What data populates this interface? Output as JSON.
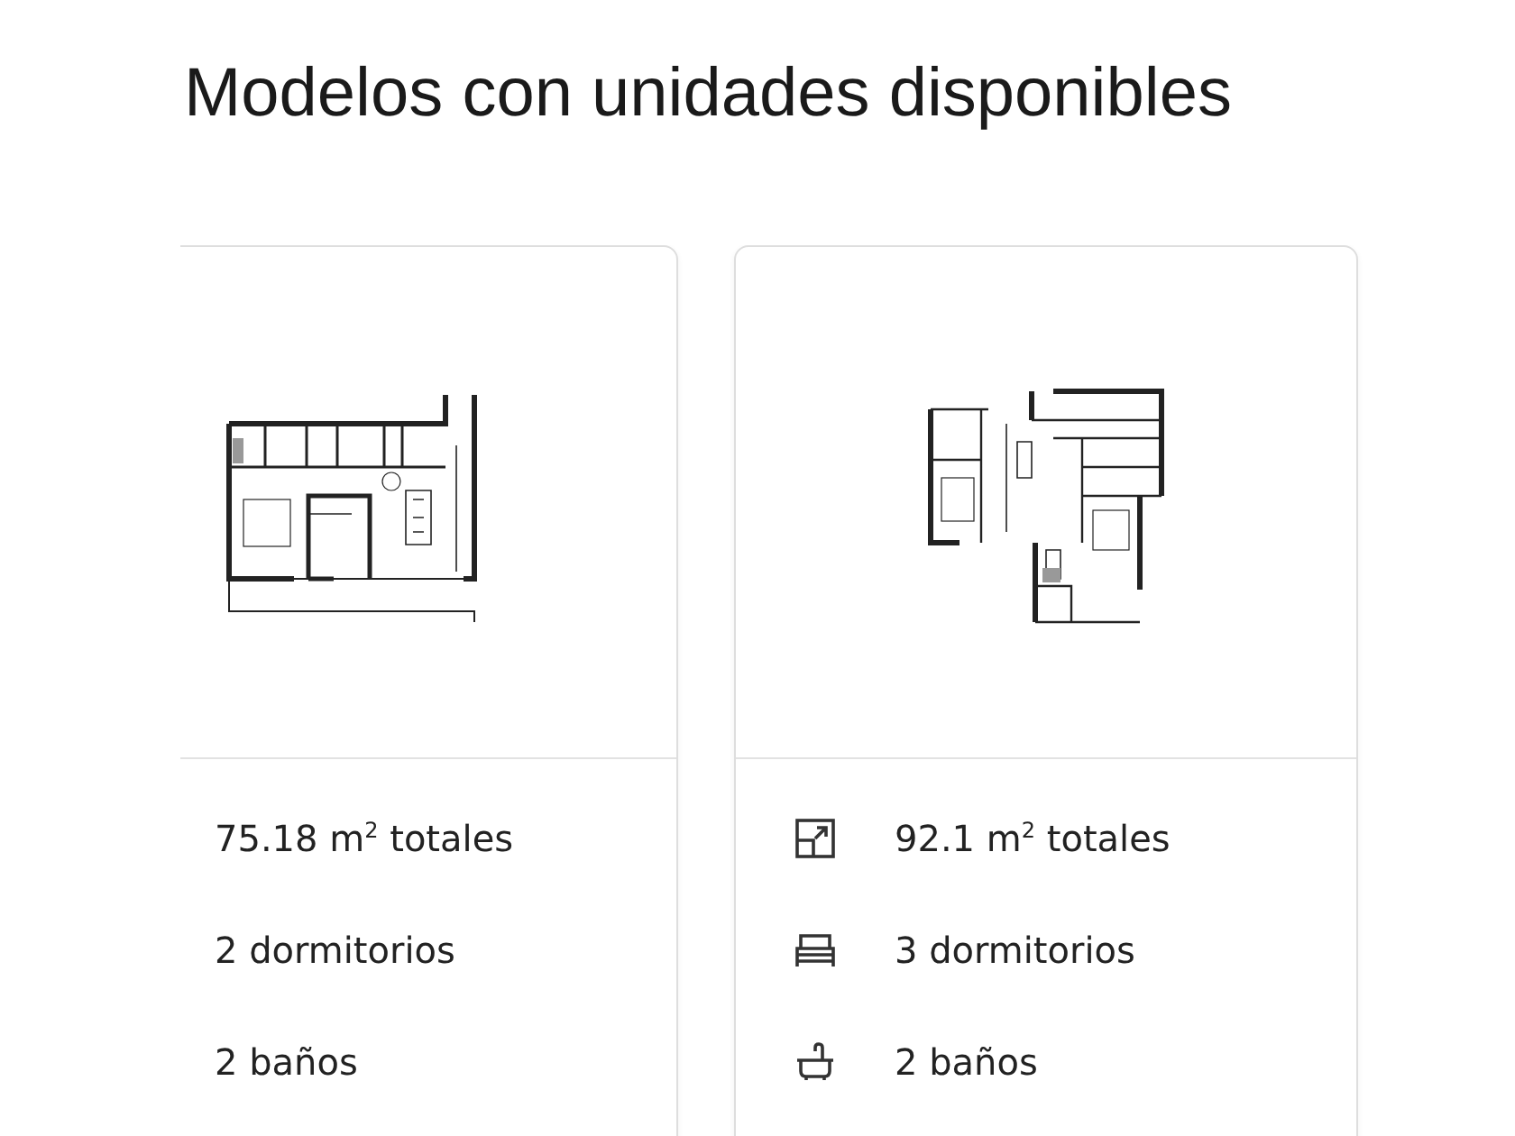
{
  "title": "Modelos con unidades disponibles",
  "models": [
    {
      "kind": "wide",
      "features": [
        {
          "text": "75.18 m$^{2}$ totales"
        },
        {
          "text": "2 dormitorios"
        },
        {
          "text": "2 baños"
        }
      ]
    },
    {
      "kind": "tall",
      "features": [
        {
          "kind": "area",
          "text": "92.1 m$^{2}$ totales"
        },
        {
          "kind": "bed",
          "text": "3 dormitorios"
        },
        {
          "kind": "bath",
          "text": "2 baños"
        }
      ]
    }
  ]
}
